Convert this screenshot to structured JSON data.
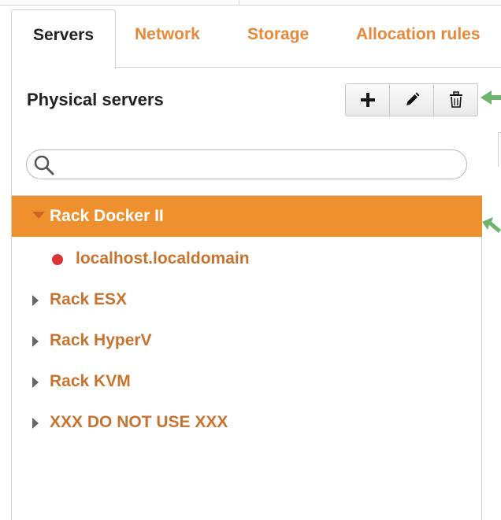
{
  "tabs": {
    "servers": "Servers",
    "network": "Network",
    "storage": "Storage",
    "allocation_rules": "Allocation rules"
  },
  "panel": {
    "title": "Physical servers"
  },
  "toolbar": {
    "add_icon": "plus-icon",
    "edit_icon": "pencil-icon",
    "delete_icon": "trash-icon"
  },
  "search": {
    "value": "",
    "placeholder": ""
  },
  "tree": {
    "racks": [
      {
        "label": "Rack Docker II",
        "expanded": true,
        "selected": true,
        "servers": [
          {
            "label": "localhost.localdomain",
            "status_color": "#d93535"
          }
        ]
      },
      {
        "label": "Rack ESX",
        "expanded": false,
        "selected": false
      },
      {
        "label": "Rack HyperV",
        "expanded": false,
        "selected": false
      },
      {
        "label": "Rack KVM",
        "expanded": false,
        "selected": false
      },
      {
        "label": "XXX DO NOT USE XXX",
        "expanded": false,
        "selected": false
      }
    ]
  },
  "colors": {
    "accent": "#ef902f",
    "tab_inactive": "#e8893a",
    "tree_text": "#c8742e",
    "annotation_arrow": "#6db56d",
    "status_error": "#d93535"
  }
}
